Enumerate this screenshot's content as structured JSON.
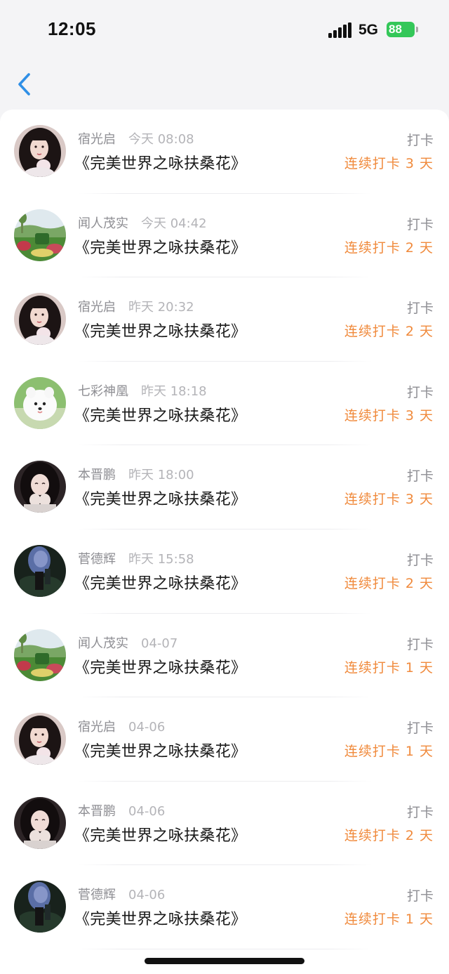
{
  "status_bar": {
    "time": "12:05",
    "network": "5G",
    "battery": "88"
  },
  "nav": {
    "back_icon": "chevron-left-icon"
  },
  "colors": {
    "accent": "#2f8fe6",
    "streak": "#f08a3c",
    "battery": "#34c759"
  },
  "rows": [
    {
      "name": "宿光启",
      "time": "今天 08:08",
      "title": "《完美世界之咏扶桑花》",
      "action": "打卡",
      "streak": "连续打卡 3 天",
      "avatar": "woman-photo"
    },
    {
      "name": "闻人茂实",
      "time": "今天 04:42",
      "title": "《完美世界之咏扶桑花》",
      "action": "打卡",
      "streak": "连续打卡 2 天",
      "avatar": "garden-photo"
    },
    {
      "name": "宿光启",
      "time": "昨天 20:32",
      "title": "《完美世界之咏扶桑花》",
      "action": "打卡",
      "streak": "连续打卡 2 天",
      "avatar": "woman-photo"
    },
    {
      "name": "七彩神凰",
      "time": "昨天 18:18",
      "title": "《完美世界之咏扶桑花》",
      "action": "打卡",
      "streak": "连续打卡 3 天",
      "avatar": "dog-photo"
    },
    {
      "name": "本晋鹏",
      "time": "昨天 18:00",
      "title": "《完美世界之咏扶桑花》",
      "action": "打卡",
      "streak": "连续打卡 3 天",
      "avatar": "girl-dark-photo"
    },
    {
      "name": "菅德辉",
      "time": "昨天 15:58",
      "title": "《完美世界之咏扶桑花》",
      "action": "打卡",
      "streak": "连续打卡 2 天",
      "avatar": "dark-figure-photo"
    },
    {
      "name": "闻人茂实",
      "time": "04-07",
      "title": "《完美世界之咏扶桑花》",
      "action": "打卡",
      "streak": "连续打卡 1 天",
      "avatar": "garden-photo"
    },
    {
      "name": "宿光启",
      "time": "04-06",
      "title": "《完美世界之咏扶桑花》",
      "action": "打卡",
      "streak": "连续打卡 1 天",
      "avatar": "woman-photo"
    },
    {
      "name": "本晋鹏",
      "time": "04-06",
      "title": "《完美世界之咏扶桑花》",
      "action": "打卡",
      "streak": "连续打卡 2 天",
      "avatar": "girl-dark-photo"
    },
    {
      "name": "菅德辉",
      "time": "04-06",
      "title": "《完美世界之咏扶桑花》",
      "action": "打卡",
      "streak": "连续打卡 1 天",
      "avatar": "dark-figure-photo"
    }
  ]
}
